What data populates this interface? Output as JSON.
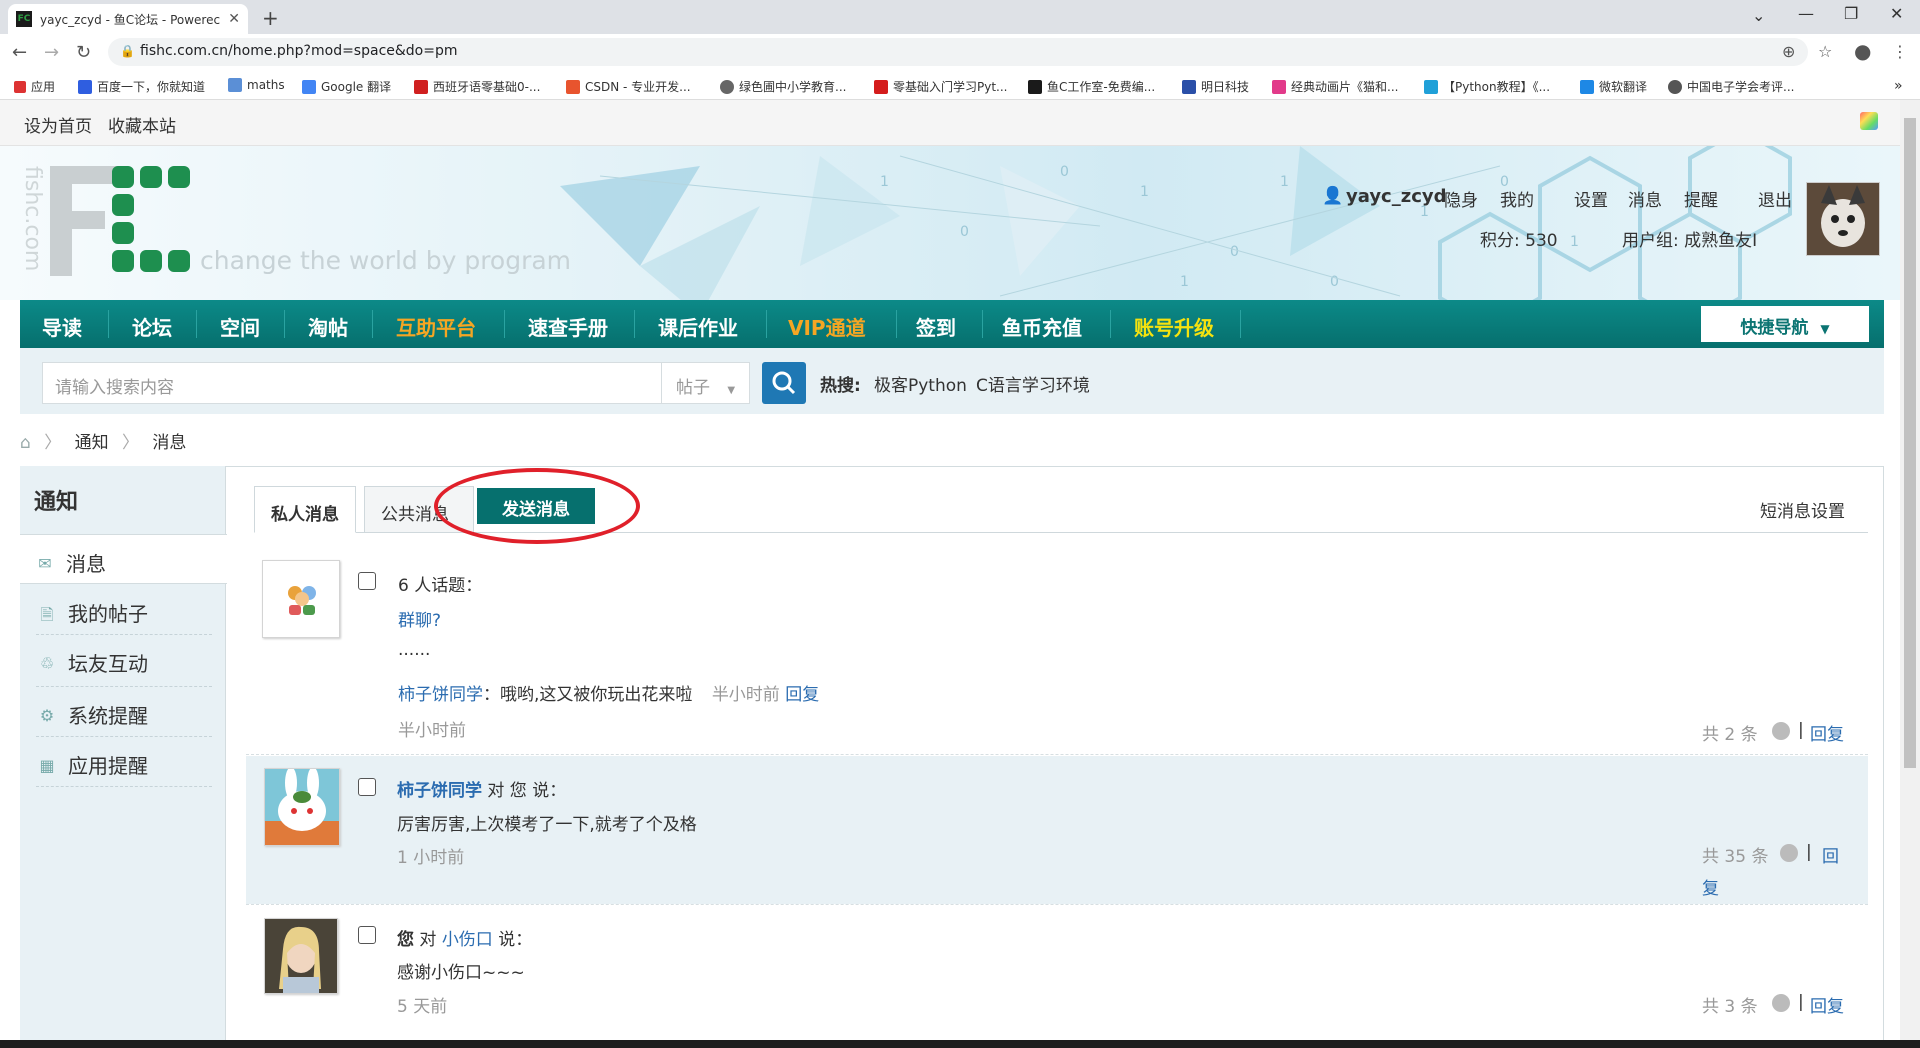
{
  "browser": {
    "tab_title": "yayc_zcyd - 鱼C论坛 - Powerec",
    "tab_favicon": "FC",
    "url": "fishc.com.cn/home.php?mod=space&do=pm",
    "bookmarks": [
      "应用",
      "百度一下，你就知道",
      "maths",
      "Google 翻译",
      "西班牙语零基础0-...",
      "CSDN - 专业开发...",
      "绿色圃中小学教育...",
      "零基础入门学习Pyt...",
      "鱼C工作室-免费编...",
      "明日科技",
      "经典动画片《猫和...",
      "【Python教程】《...",
      "微软翻译",
      "中国电子学会考评..."
    ]
  },
  "topbar": {
    "set_home": "设为首页",
    "bookmark_site": "收藏本站"
  },
  "header": {
    "slogan": "change the world by program",
    "side_text": "fishc.com",
    "username": "yayc_zcyd",
    "user_links": [
      "隐身",
      "我的",
      "设置",
      "消息",
      "提醒",
      "退出"
    ],
    "points": "积分: 530",
    "user_group": "用户组: 成熟鱼友Ⅰ"
  },
  "nav": {
    "items": [
      "导读",
      "论坛",
      "空间",
      "淘帖",
      "互助平台",
      "速查手册",
      "课后作业",
      "VIP通道",
      "签到",
      "鱼币充值",
      "账号升级"
    ],
    "quick_nav": "快捷导航"
  },
  "search": {
    "placeholder": "请输入搜索内容",
    "type": "帖子",
    "hot_label": "热搜:",
    "hot_items": [
      "极客Python",
      "C语言学习环境"
    ]
  },
  "breadcrumb": [
    "通知",
    "消息"
  ],
  "sidebar": {
    "title": "通知",
    "items": [
      "消息",
      "我的帖子",
      "坛友互动",
      "系统提醒",
      "应用提醒"
    ]
  },
  "tabs": {
    "private": "私人消息",
    "public": "公共消息",
    "send": "发送消息",
    "settings": "短消息设置"
  },
  "messages": [
    {
      "head": "6 人话题：",
      "topic": "群聊?",
      "body": "......",
      "last_author": "柿子饼同学",
      "last_text": "：哦哟,这又被你玩出花来啦",
      "last_time": "半小时前",
      "reply_inline": "回复",
      "time": "半小时前",
      "count": "共 2 条",
      "reply": "回复"
    },
    {
      "author": "柿子饼同学",
      "mid": "对 您 说：",
      "body": "厉害厉害,上次模考了一下,就考了个及格",
      "time": "1 小时前",
      "count": "共 35 条",
      "reply1": "回",
      "reply2": "复"
    },
    {
      "author": "您",
      "mid": "对",
      "target": "小伤口",
      "tail": "说：",
      "body": "感谢小伤口~~~",
      "time": "5 天前",
      "count": "共 3 条",
      "reply": "回复"
    }
  ],
  "colors": {
    "nav_bg": "#0a7f7d",
    "highlight_orange": "#f5a623",
    "highlight_yellow": "#f5e20f",
    "link": "#2b6cb0",
    "annotation": "#e0202a"
  }
}
